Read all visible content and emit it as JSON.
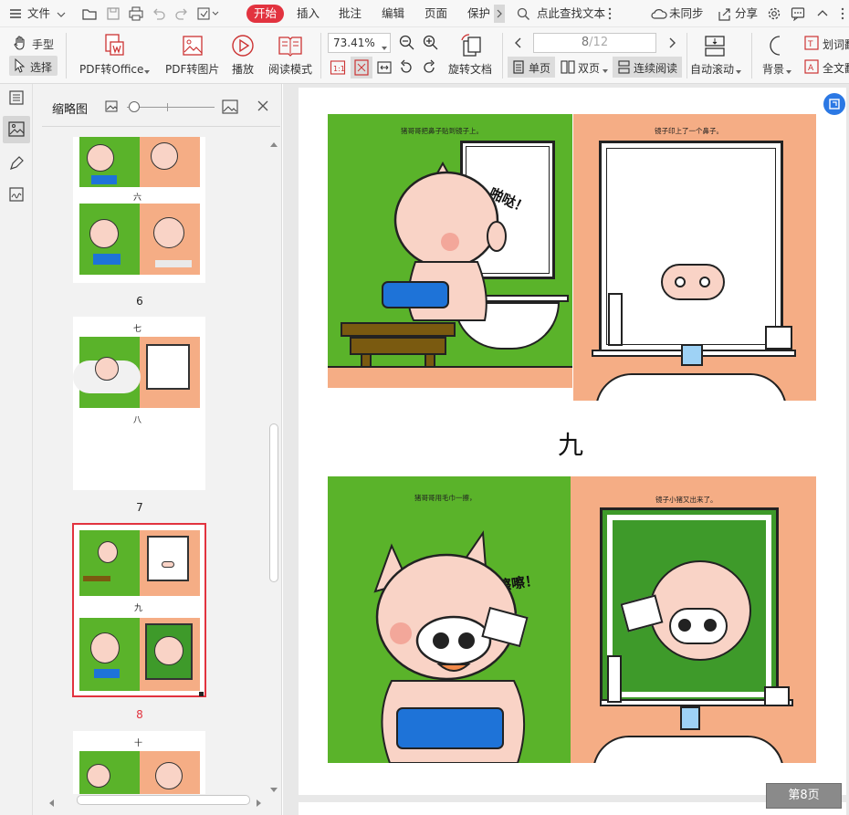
{
  "menubar": {
    "file_label": "文件",
    "tabs": [
      "开始",
      "插入",
      "批注",
      "编辑",
      "页面",
      "保护"
    ],
    "active_tab": "开始",
    "search_label": "点此查找文本",
    "sync_label": "未同步",
    "share_label": "分享"
  },
  "toolbar": {
    "hand_label": "手型",
    "select_label": "选择",
    "pdf_office_label": "PDF转Office",
    "pdf_image_label": "PDF转图片",
    "play_label": "播放",
    "read_mode_label": "阅读模式",
    "zoom_value": "73.41%",
    "rotate_label": "旋转文档",
    "page_current": "8",
    "page_total": "/12",
    "single_page_label": "单页",
    "double_page_label": "双页",
    "continuous_label": "连续阅读",
    "autoscroll_label": "自动滚动",
    "background_label": "背景",
    "word_label": "划词翻",
    "fulltext_label": "全文翻"
  },
  "sidebar": {
    "title": "缩略图",
    "thumbnails": [
      {
        "chapter": "六",
        "page": "6"
      },
      {
        "chapter": "七",
        "sub": "八",
        "page": "7"
      },
      {
        "chapter": "九",
        "page": "8"
      },
      {
        "chapter": "十",
        "page": ""
      }
    ]
  },
  "document": {
    "chapter_label": "九",
    "captions": {
      "p1_left": "猪哥哥把鼻子贴到镜子上。",
      "p1_right": "镜子印上了一个鼻子。",
      "p2_left": "猪哥哥用毛巾一擦，",
      "p2_right": "镜子小猪又出来了。"
    },
    "sfx1": "啪哒！",
    "sfx2": "嚓嚓！",
    "page_badge": "第8页"
  },
  "colors": {
    "accent": "#e2333f",
    "green": "#5ab32a",
    "salmon": "#f5ad85",
    "pig": "#f9d3c6"
  }
}
